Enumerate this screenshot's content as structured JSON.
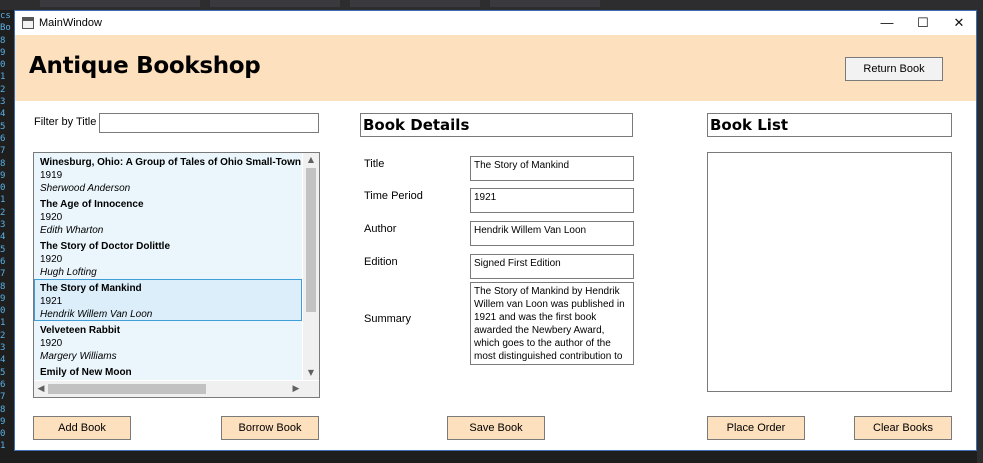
{
  "ide_gutter": [
    "cs",
    "Bo",
    "8",
    "9",
    "0",
    "1",
    "2",
    "3",
    "4",
    "5",
    "6",
    "7",
    "8",
    "9",
    "0",
    "1",
    "2",
    "3",
    "4",
    "5",
    "6",
    "7",
    "8",
    "9",
    "0",
    "1",
    "2",
    "3",
    "4",
    "5",
    "6",
    "7",
    "8",
    "9",
    "0",
    "1"
  ],
  "window": {
    "title": "MainWindow",
    "minimize_glyph": "—",
    "maximize_glyph": "☐",
    "close_glyph": "✕"
  },
  "header": {
    "title": "Antique Bookshop",
    "return_button": "Return Book"
  },
  "filter": {
    "label": "Filter by Title",
    "value": ""
  },
  "books": [
    {
      "title": "Winesburg, Ohio: A Group of Tales of Ohio Small-Town Life",
      "year": "1919",
      "author": "Sherwood Anderson",
      "selected": false
    },
    {
      "title": "The Age of Innocence",
      "year": "1920",
      "author": "Edith Wharton",
      "selected": false
    },
    {
      "title": "The Story of Doctor Dolittle",
      "year": "1920",
      "author": "Hugh Lofting",
      "selected": false
    },
    {
      "title": "The Story of Mankind",
      "year": "1921",
      "author": "Hendrik Willem Van Loon",
      "selected": true
    },
    {
      "title": "Velveteen Rabbit",
      "year": "1920",
      "author": "Margery Williams",
      "selected": false
    },
    {
      "title": "Emily of New Moon",
      "year": "",
      "author": "",
      "selected": false
    }
  ],
  "scroll_glyphs": {
    "up": "▲",
    "down": "▼",
    "left": "◀",
    "right": "▶"
  },
  "details": {
    "header": "Book Details",
    "title_label": "Title",
    "title_value": "The Story of Mankind",
    "period_label": "Time Period",
    "period_value": "1921",
    "author_label": "Author",
    "author_value": "Hendrik Willem Van Loon",
    "edition_label": "Edition",
    "edition_value": "Signed First Edition",
    "summary_label": "Summary",
    "summary_value": "The Story of Mankind by Hendrik Willem van Loon was published in 1921 and was the first book awarded the Newbery Award, which goes to the author of the most distinguished contribution to"
  },
  "book_list": {
    "header": "Book List"
  },
  "buttons": {
    "add": "Add Book",
    "borrow": "Borrow Book",
    "save": "Save Book",
    "order": "Place Order",
    "clear": "Clear Books"
  },
  "colors": {
    "accent": "#fde0bd",
    "selection_border": "#3f9ed8",
    "list_background": "#eaf6fc"
  }
}
